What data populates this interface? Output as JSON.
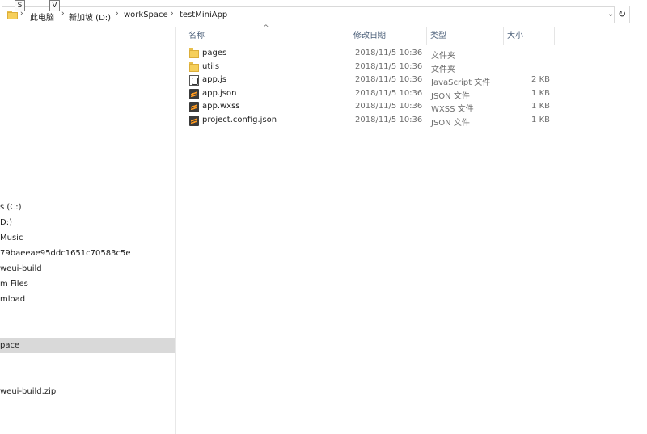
{
  "address_bar": {
    "breadcrumbs": [
      "此电脑",
      "新加坡 (D:)",
      "workSpace",
      "testMiniApp"
    ],
    "access_keys": [
      "S",
      "V"
    ]
  },
  "nav_pane": {
    "items": [
      {
        "label": "s (C:)",
        "selected": false
      },
      {
        "label": "D:)",
        "selected": false
      },
      {
        "label": "Music",
        "selected": false
      },
      {
        "label": "79baeeae95ddc1651c70583c5e",
        "selected": false
      },
      {
        "label": "weui-build",
        "selected": false
      },
      {
        "label": "m Files",
        "selected": false
      },
      {
        "label": "mload",
        "selected": false
      },
      {
        "label": "pace",
        "selected": true
      },
      {
        "label": "weui-build.zip",
        "selected": false
      }
    ]
  },
  "file_list": {
    "columns": {
      "name": "名称",
      "modified": "修改日期",
      "type": "类型",
      "size": "大小"
    },
    "sort_indicator": "^",
    "files": [
      {
        "name": "pages",
        "modified": "2018/11/5 10:36",
        "type": "文件夹",
        "size": "",
        "icon": "folder-icon"
      },
      {
        "name": "utils",
        "modified": "2018/11/5 10:36",
        "type": "文件夹",
        "size": "",
        "icon": "folder-icon"
      },
      {
        "name": "app.js",
        "modified": "2018/11/5 10:36",
        "type": "JavaScript 文件",
        "size": "2 KB",
        "icon": "js-file-icon"
      },
      {
        "name": "app.json",
        "modified": "2018/11/5 10:36",
        "type": "JSON 文件",
        "size": "1 KB",
        "icon": "sublime-file-icon"
      },
      {
        "name": "app.wxss",
        "modified": "2018/11/5 10:36",
        "type": "WXSS 文件",
        "size": "1 KB",
        "icon": "sublime-file-icon"
      },
      {
        "name": "project.config.json",
        "modified": "2018/11/5 10:36",
        "type": "JSON 文件",
        "size": "1 KB",
        "icon": "sublime-file-icon"
      }
    ]
  }
}
